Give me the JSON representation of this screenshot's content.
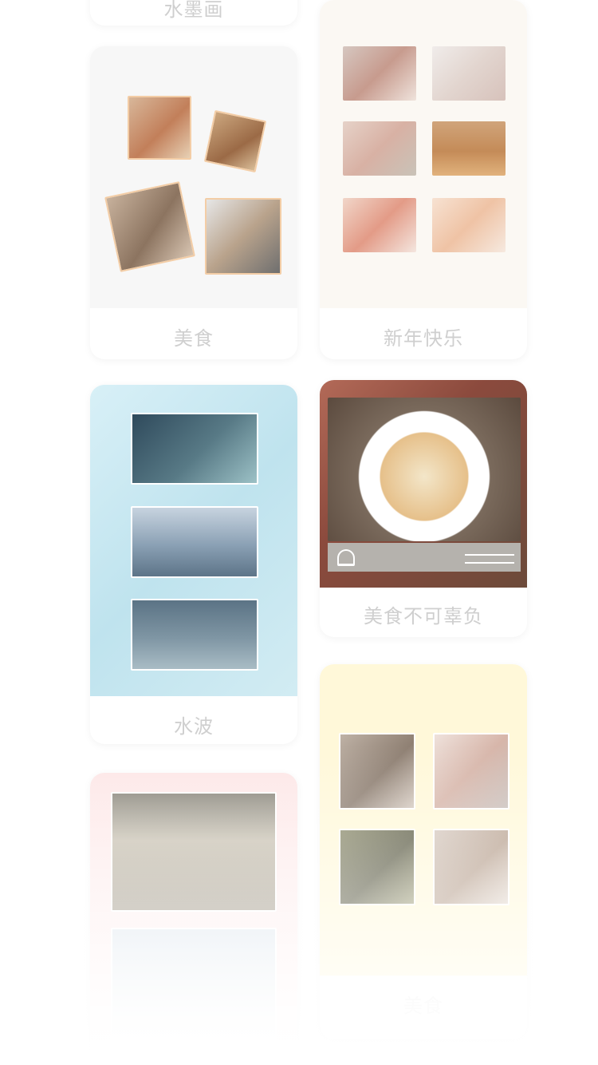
{
  "templates": [
    {
      "id": "ink",
      "label": "水墨画"
    },
    {
      "id": "food",
      "label": "美食"
    },
    {
      "id": "newyear",
      "label": "新年快乐"
    },
    {
      "id": "water",
      "label": "水波"
    },
    {
      "id": "gourmet",
      "label": "美食不可辜负"
    },
    {
      "id": "yellow",
      "label": "美食"
    },
    {
      "id": "red",
      "label": ""
    }
  ]
}
